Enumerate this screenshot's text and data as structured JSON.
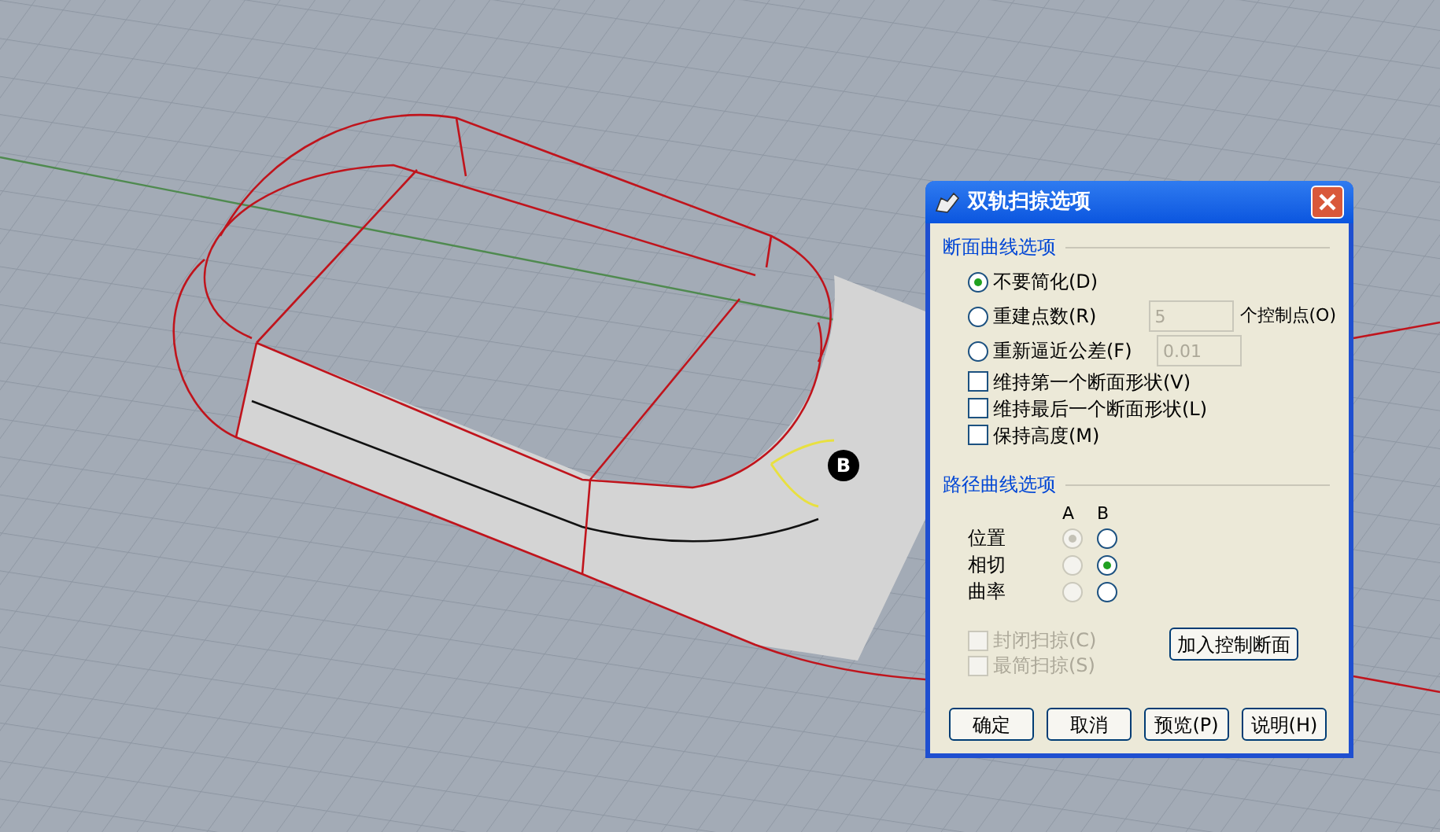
{
  "viewport": {
    "marker_label": "B"
  },
  "dialog": {
    "title": "双轨扫掠选项",
    "section_options": {
      "heading": "断面曲线选项",
      "radios": [
        {
          "label": "不要简化(D)",
          "selected": true
        },
        {
          "label": "重建点数(R)",
          "selected": false,
          "field": {
            "value": "5",
            "disabled": true
          },
          "suffix": "个控制点(O)"
        },
        {
          "label": "重新逼近公差(F)",
          "selected": false,
          "field": {
            "value": "0.01",
            "disabled": true
          }
        }
      ],
      "checkboxes": [
        {
          "label": "维持第一个断面形状(V)",
          "checked": false
        },
        {
          "label": "维持最后一个断面形状(L)",
          "checked": false
        },
        {
          "label": "保持高度(M)",
          "checked": false
        }
      ]
    },
    "rail_options": {
      "heading": "路径曲线选项",
      "columns": [
        "A",
        "B"
      ],
      "rows": [
        {
          "label": "位置",
          "a": {
            "selected": true,
            "disabled": true
          },
          "b": {
            "selected": false,
            "disabled": false
          }
        },
        {
          "label": "相切",
          "a": {
            "selected": false,
            "disabled": true
          },
          "b": {
            "selected": true,
            "disabled": false
          }
        },
        {
          "label": "曲率",
          "a": {
            "selected": false,
            "disabled": true
          },
          "b": {
            "selected": false,
            "disabled": false
          }
        }
      ],
      "checkboxes": [
        {
          "label": "封闭扫掠(C)",
          "checked": false,
          "disabled": true
        },
        {
          "label": "最简扫掠(S)",
          "checked": false,
          "disabled": true
        }
      ],
      "add_button": "加入控制断面"
    },
    "buttons": [
      "确定",
      "取消",
      "预览(P)",
      "说明(H)"
    ]
  }
}
